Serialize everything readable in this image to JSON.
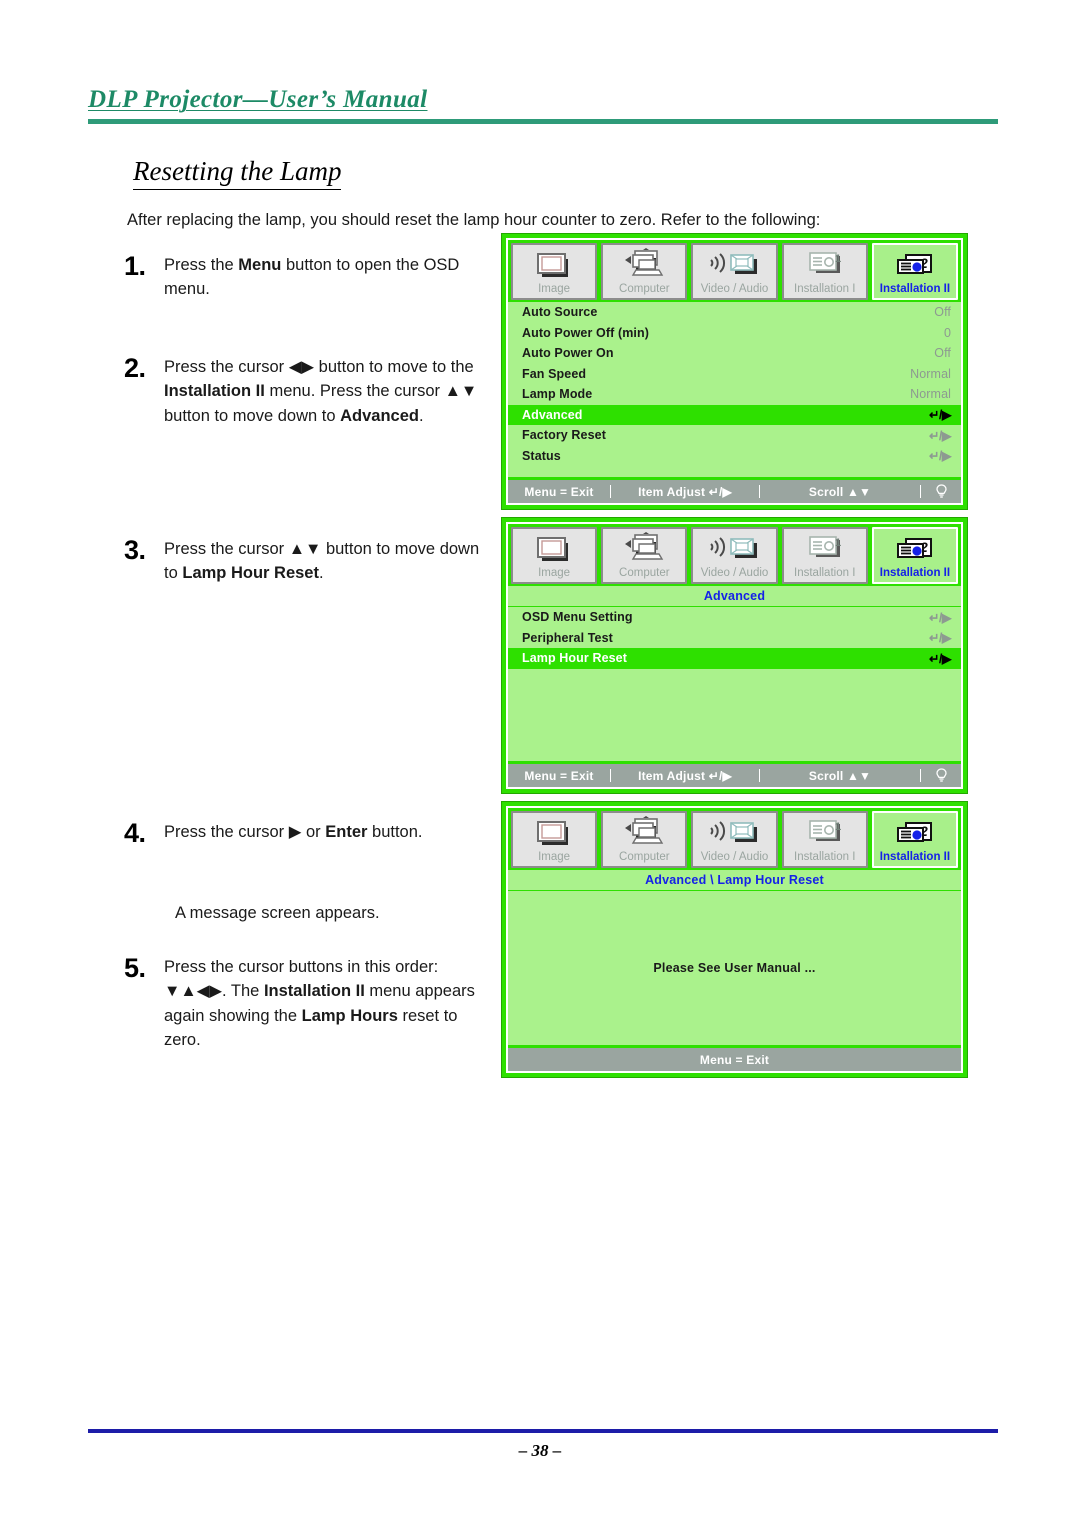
{
  "header": {
    "title": "DLP Projector—User’s Manual"
  },
  "section": {
    "heading": "Resetting the Lamp",
    "intro": "After replacing the lamp, you should reset the lamp hour counter to zero. Refer to the following:"
  },
  "steps": [
    {
      "num": "1.",
      "text_html": "Press the <b>Menu</b> button to open the OSD menu."
    },
    {
      "num": "2.",
      "text_html": "Press the cursor ◀▶ button to move to the <b>Installation II</b> menu. Press the cursor ▲▼ button to move down to <b>Advanced</b>."
    },
    {
      "num": "3.",
      "text_html": "Press the cursor ▲▼ button to move down to <b>Lamp Hour Reset</b>."
    },
    {
      "num": "4.",
      "text_html": "Press the cursor ▶ or <b>Enter</b> button."
    },
    {
      "num": "5.",
      "text_html": "Press the cursor buttons in this order: ▼▲◀▶. The <b>Installation II</b> menu appears again showing the <b>Lamp Hours</b> reset to zero."
    }
  ],
  "message_line": "A message screen appears.",
  "osd": {
    "tabs": [
      {
        "label": "Image",
        "icon": "image-tab-icon",
        "active": false
      },
      {
        "label": "Computer",
        "icon": "computer-tab-icon",
        "active": false
      },
      {
        "label": "Video / Audio",
        "icon": "video-audio-tab-icon",
        "active": false
      },
      {
        "label": "Installation I",
        "icon": "installation-1-tab-icon",
        "active": false
      },
      {
        "label": "Installation II",
        "icon": "installation-2-tab-icon",
        "active": true
      }
    ],
    "status": {
      "exit": "Menu = Exit",
      "adjust": "Item Adjust ↵/▶",
      "scroll": "Scroll ▲▼",
      "lamp_icon": "lamp-icon"
    },
    "panel1": {
      "rows": [
        {
          "label": "Auto Source",
          "value": "Off",
          "highlight": false
        },
        {
          "label": "Auto Power Off (min)",
          "value": "0",
          "highlight": false
        },
        {
          "label": "Auto Power On",
          "value": "Off",
          "highlight": false
        },
        {
          "label": "Fan Speed",
          "value": "Normal",
          "highlight": false
        },
        {
          "label": "Lamp Mode",
          "value": "Normal",
          "highlight": false
        },
        {
          "label": "Advanced",
          "value": "↵/▶",
          "highlight": true
        },
        {
          "label": "Factory Reset",
          "value": "↵/▶",
          "highlight": false
        },
        {
          "label": "Status",
          "value": "↵/▶",
          "highlight": false
        }
      ]
    },
    "panel2": {
      "subtitle": "Advanced",
      "rows": [
        {
          "label": "OSD Menu Setting",
          "value": "↵/▶",
          "highlight": false
        },
        {
          "label": "Peripheral Test",
          "value": "↵/▶",
          "highlight": false
        },
        {
          "label": "Lamp Hour Reset",
          "value": "↵/▶",
          "highlight": true
        }
      ]
    },
    "panel3": {
      "subtitle": "Advanced \\ Lamp Hour Reset",
      "message": "Please See User Manual ...",
      "status_exit": "Menu = Exit"
    }
  },
  "footer": {
    "page_number": "– 38 –"
  },
  "colors": {
    "header_green": "#2e9b79",
    "osd_border_green": "#2ee000",
    "osd_row_bg": "#aaf28c",
    "osd_highlight": "#2ee000",
    "tab_active_text": "#1521e8",
    "status_bar": "#9aa5a0",
    "footer_rule": "#1c1ca8"
  }
}
